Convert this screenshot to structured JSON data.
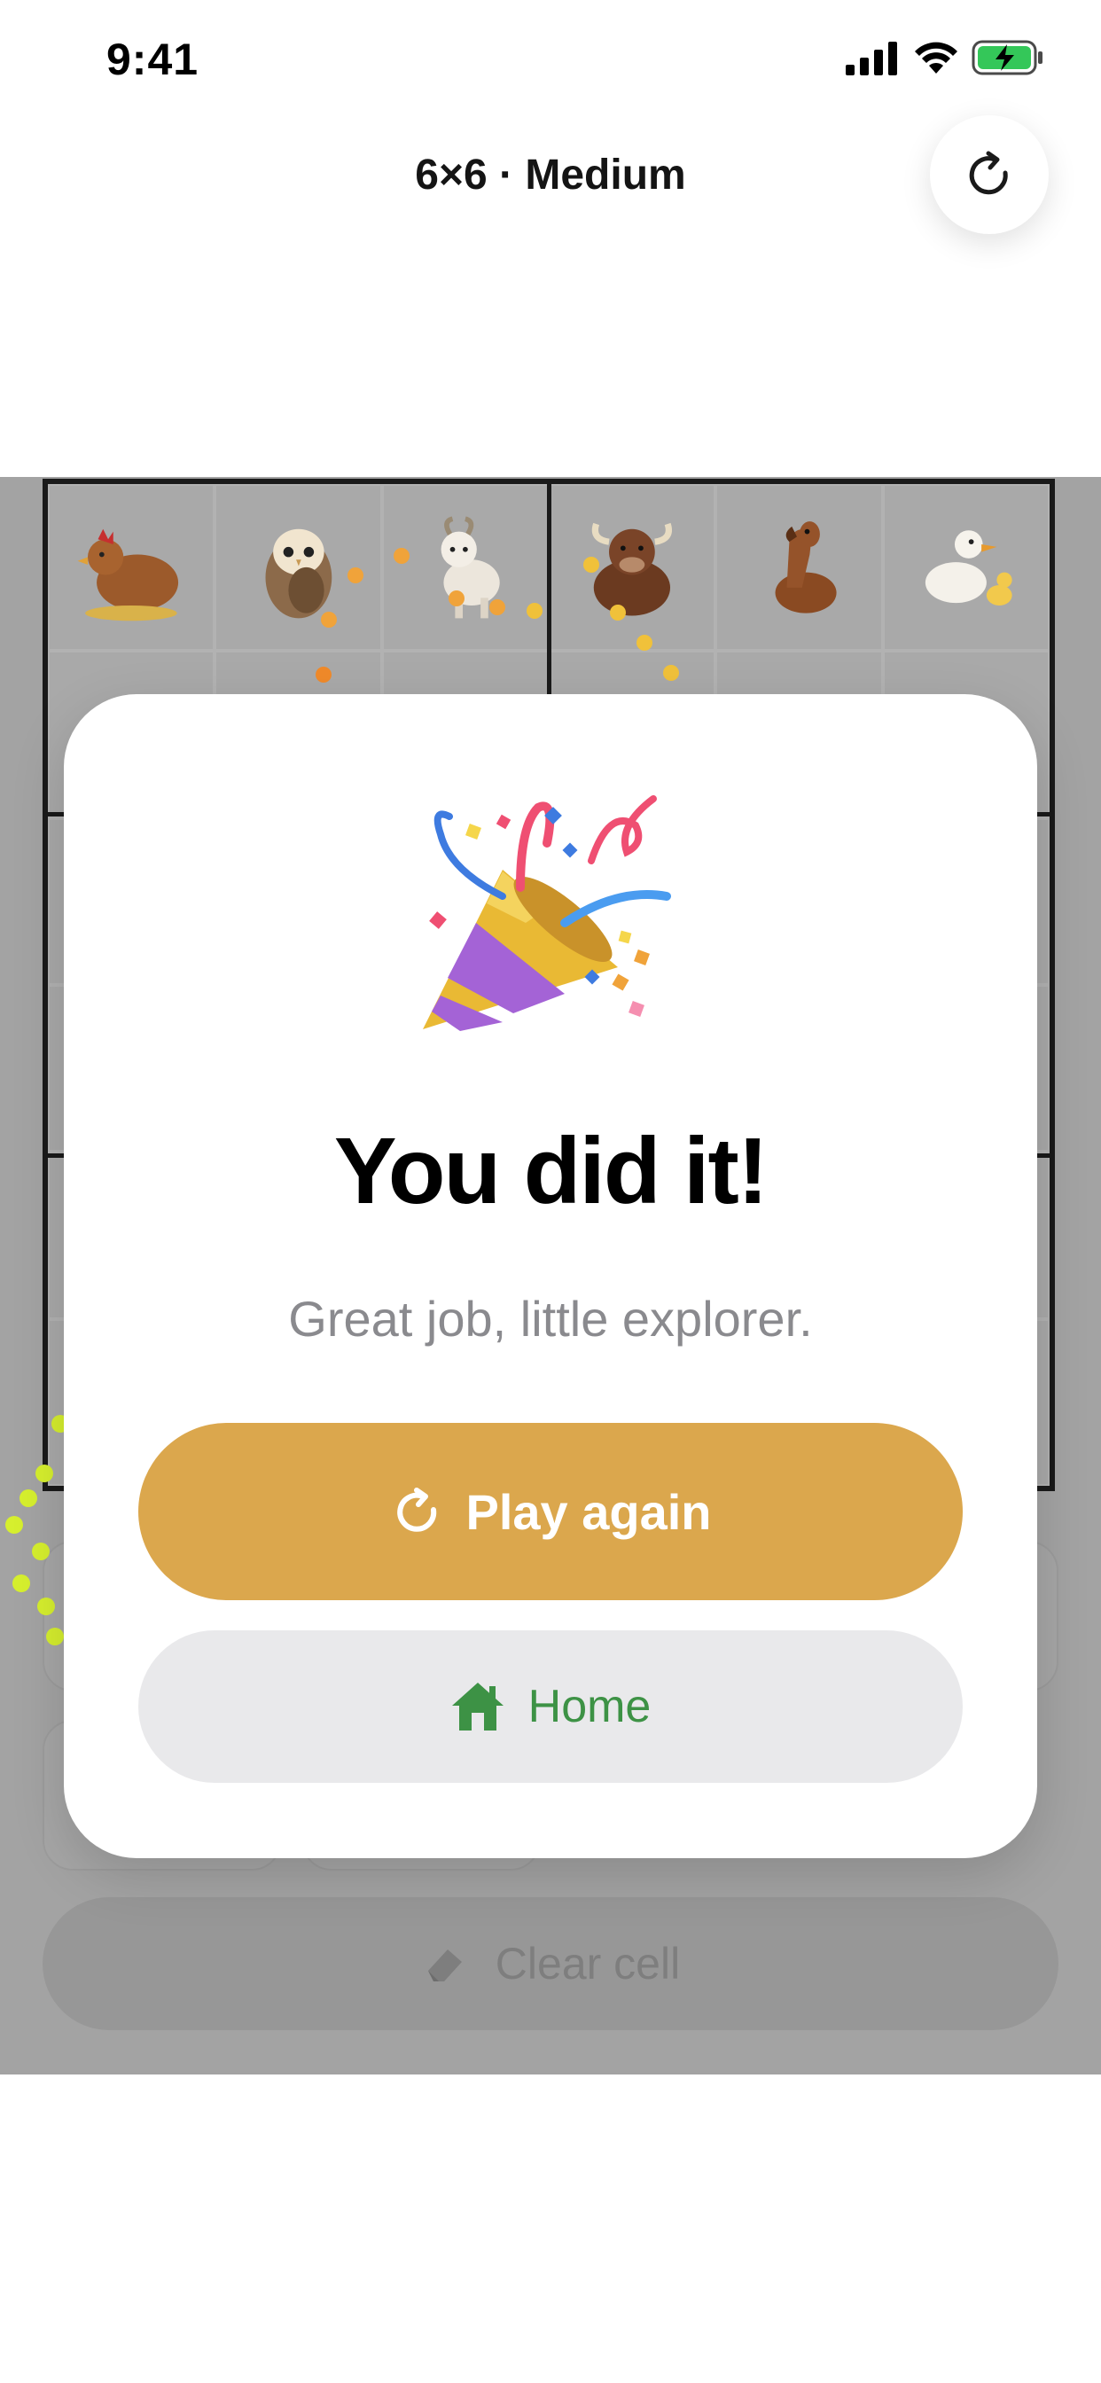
{
  "status_bar": {
    "time": "9:41",
    "icons": [
      "signal-icon",
      "wifi-icon",
      "battery-charging-icon"
    ]
  },
  "header": {
    "title": "6×6 · Medium",
    "refresh_icon": "refresh-icon"
  },
  "grid": {
    "size": 6,
    "first_row": [
      "hen",
      "owl",
      "goat",
      "bull",
      "horse",
      "duck"
    ]
  },
  "controls": {
    "clear_cell_label": "Clear cell",
    "clear_cell_icon": "eraser-icon"
  },
  "modal": {
    "icon": "party-popper-icon",
    "title": "You did it!",
    "subtitle": "Great job, little explorer.",
    "play_again_label": "Play again",
    "play_again_icon": "refresh-icon",
    "home_label": "Home",
    "home_icon": "house-icon"
  },
  "colors": {
    "accent": "#dba74d",
    "home_green": "#3d9245",
    "backdrop": "#a3a3a3",
    "battery_green": "#34c759"
  }
}
